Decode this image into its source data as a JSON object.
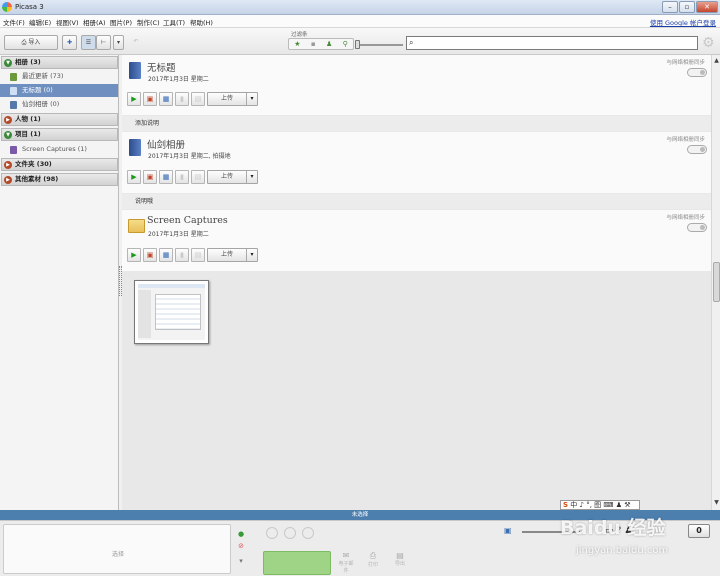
{
  "window": {
    "title": "Picasa 3"
  },
  "menu": {
    "items": [
      "文件(F)",
      "编辑(E)",
      "视图(V)",
      "相册(A)",
      "图片(P)",
      "制作(C)",
      "工具(T)",
      "帮助(H)"
    ],
    "signin": "使用 Google 帐户登录"
  },
  "toolbar": {
    "import_label": "导入",
    "filter_label": "过滤条",
    "search_placeholder": ""
  },
  "sidebar": {
    "sections": [
      {
        "label": "相册 (3)",
        "expanded": true
      },
      {
        "label": "人物 (1)",
        "expanded": false
      },
      {
        "label": "项目 (1)",
        "expanded": true
      },
      {
        "label": "文件夹 (30)",
        "expanded": false
      },
      {
        "label": "其他素材 (98)",
        "expanded": false
      }
    ],
    "items": [
      {
        "label": "最近更新 (73)",
        "selected": false
      },
      {
        "label": "无标题 (0)",
        "selected": true
      },
      {
        "label": "仙剑相册 (0)",
        "selected": false
      },
      {
        "label": "Screen Captures (1)",
        "selected": false
      }
    ]
  },
  "albums": [
    {
      "title": "无标题",
      "date": "2017年1月3日 星期二",
      "sync_label": "与网络相册同步",
      "upload_label": "上传",
      "caption": "添加说明"
    },
    {
      "title": "仙剑相册",
      "date": "2017年1月3日 星期二, 拍摄地",
      "sync_label": "与网络相册同步",
      "upload_label": "上传",
      "caption": "说明哦"
    },
    {
      "title": "Screen Captures",
      "date": "2017年1月3日 星期二",
      "sync_label": "与网络相册同步",
      "upload_label": "上传"
    }
  ],
  "selection_bar": {
    "label": "未选择"
  },
  "tray": {
    "placeholder": "选择",
    "count": "0",
    "buttons": [
      "电子邮件",
      "打印",
      "导出"
    ]
  },
  "ime": {
    "text": "中 ♪ °, 图 ⌨ ♟ ⚒"
  },
  "watermark": {
    "brand": "Baidu 经验",
    "url": "jingyan.baidu.com"
  },
  "colors": {
    "selection": "#6e8fbf",
    "bar": "#4c7fae",
    "play": "#1a9a1a"
  }
}
